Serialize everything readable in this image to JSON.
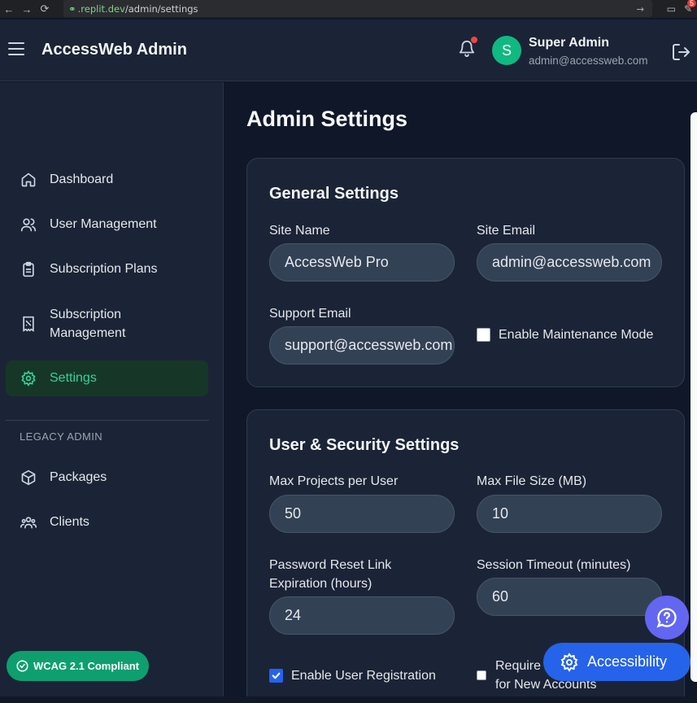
{
  "browser": {
    "url_host": ".replit.dev",
    "url_path": "/admin/settings",
    "extension_badge": "5"
  },
  "header": {
    "app_title": "AccessWeb Admin",
    "avatar_initial": "S",
    "user_name": "Super Admin",
    "user_email": "admin@accessweb.com"
  },
  "sidebar": {
    "items": [
      {
        "label": "Dashboard",
        "icon": "home-icon"
      },
      {
        "label": "User Management",
        "icon": "users-icon"
      },
      {
        "label": "Subscription Plans",
        "icon": "clipboard-icon"
      },
      {
        "label": "Subscription Management",
        "icon": "receipt-icon"
      },
      {
        "label": "Settings",
        "icon": "gear-icon",
        "active": true
      }
    ],
    "section_label": "LEGACY ADMIN",
    "legacy_items": [
      {
        "label": "Packages",
        "icon": "package-icon"
      },
      {
        "label": "Clients",
        "icon": "clients-icon"
      }
    ],
    "wcag_badge": "WCAG 2.1 Compliant"
  },
  "main": {
    "page_title": "Admin Settings",
    "general": {
      "title": "General Settings",
      "site_name_label": "Site Name",
      "site_name_value": "AccessWeb Pro",
      "site_email_label": "Site Email",
      "site_email_value": "admin@accessweb.com",
      "support_email_label": "Support Email",
      "support_email_value": "support@accessweb.com",
      "maintenance_label": "Enable Maintenance Mode",
      "maintenance_checked": false
    },
    "security": {
      "title": "User & Security Settings",
      "max_projects_label": "Max Projects per User",
      "max_projects_value": "50",
      "max_file_label": "Max File Size (MB)",
      "max_file_value": "10",
      "reset_label_1": "Password Reset Link",
      "reset_label_2": "Expiration (hours)",
      "reset_value": "24",
      "session_label": "Session Timeout (minutes)",
      "session_value": "60",
      "registration_label": "Enable User Registration",
      "registration_checked": true,
      "require_label_1": "Require",
      "require_label_2": "for New Accounts",
      "require_checked": false
    }
  },
  "floating": {
    "accessibility_label": "Accessibility"
  },
  "colors": {
    "background": "#0f1729",
    "panel": "#1b2436",
    "accent_green": "#10b981",
    "primary_blue": "#2563eb",
    "help_purple": "#6366f1"
  }
}
